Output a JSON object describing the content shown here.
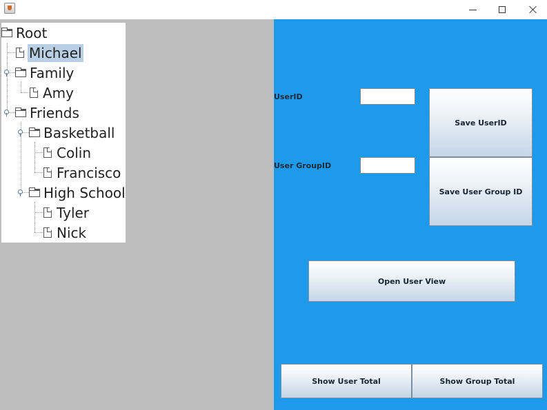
{
  "window": {
    "controls": {
      "minimize_icon": "minimize-icon",
      "maximize_icon": "maximize-icon",
      "close_icon": "close-icon"
    }
  },
  "tree": {
    "nodes": [
      {
        "label": "Root",
        "icon": "folder-icon"
      },
      {
        "label": "Michael",
        "icon": "file-icon",
        "selected": true
      },
      {
        "label": "Family",
        "icon": "folder-icon"
      },
      {
        "label": "Amy",
        "icon": "file-icon"
      },
      {
        "label": "Friends",
        "icon": "folder-icon"
      },
      {
        "label": "Basketball",
        "icon": "folder-icon"
      },
      {
        "label": "Colin",
        "icon": "file-icon"
      },
      {
        "label": "Francisco",
        "icon": "file-icon"
      },
      {
        "label": "High School",
        "icon": "folder-icon"
      },
      {
        "label": "Tyler",
        "icon": "file-icon"
      },
      {
        "label": "Nick",
        "icon": "file-icon"
      }
    ]
  },
  "form": {
    "userid_label": "UserID",
    "userid_value": "",
    "group_label": "User GroupID",
    "group_value": "",
    "save_userid_button": "Save UserID",
    "save_group_button": "Save User Group ID",
    "open_user_view_button": "Open User View",
    "show_user_total_button": "Show User Total",
    "show_group_total_button": "Show Group Total"
  },
  "colors": {
    "panel_background": "#1e9aea",
    "left_background": "#bebebe",
    "selection": "#b8cfe5"
  }
}
